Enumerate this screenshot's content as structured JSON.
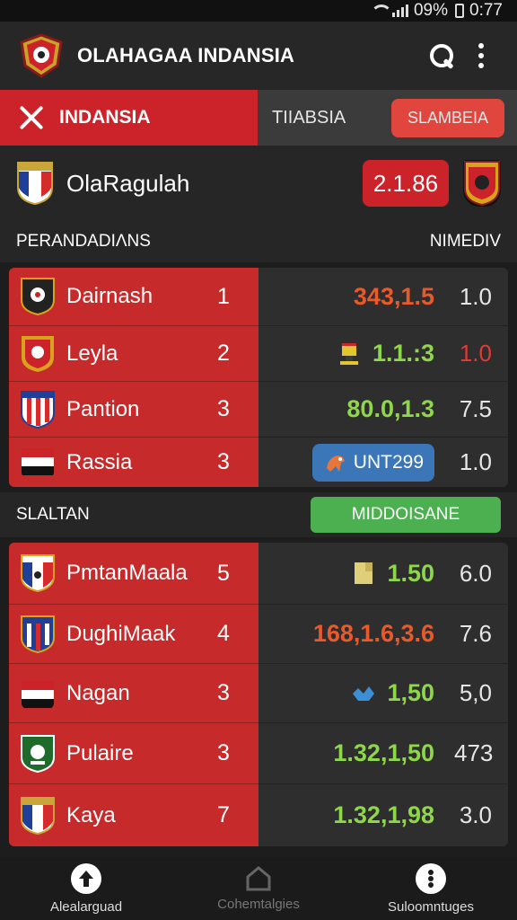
{
  "status": {
    "battery": "09%",
    "time": "0:77"
  },
  "app": {
    "title": "OLAHAGAA INDANSIA"
  },
  "tabs": {
    "active_label": "INDANSIA",
    "inactive_label": "TIIABSIA",
    "button_label": "SLAMBEIA"
  },
  "match": {
    "name": "OlaRagulah",
    "score": "2.1.86"
  },
  "section1": {
    "title": "PERANDADIΛNS",
    "right": "NIMEDIV"
  },
  "table1": [
    {
      "name": "Dairnash",
      "pos": "1",
      "odds": "343,1.5",
      "last": "1.0",
      "crest_icon": "shield-crest-icon"
    },
    {
      "name": "Leyla",
      "pos": "2",
      "odds": "1.1.:3",
      "last": "1.0",
      "crest_icon": "eagle-crest-icon"
    },
    {
      "name": "Pantion",
      "pos": "3",
      "odds": "80.0,1.3",
      "last": "7.5",
      "crest_icon": "striped-crest-icon"
    },
    {
      "name": "Rassia",
      "pos": "3",
      "odds": "UNT299",
      "last": "1.0",
      "crest_icon": "flag-crest-icon"
    }
  ],
  "section2": {
    "title": "SLALTAN",
    "badge": "MIDDOISANE"
  },
  "table2": [
    {
      "name": "PmtanMaala",
      "pos": "5",
      "odds": "1.50",
      "last": "6.0",
      "crest_icon": "shield-crest-icon"
    },
    {
      "name": "DughiMaak",
      "pos": "4",
      "odds": "168,1.6,3.6",
      "last": "7.6",
      "crest_icon": "striped-crest-icon"
    },
    {
      "name": "Nagan",
      "pos": "3",
      "odds": "1,50",
      "last": "5,0",
      "crest_icon": "flag-crest-icon"
    },
    {
      "name": "Pulaire",
      "pos": "3",
      "odds": "1.32,1,50",
      "last": "473",
      "crest_icon": "green-crest-icon"
    },
    {
      "name": "Kaya",
      "pos": "7",
      "odds": "1.32,1,98",
      "last": "3.0",
      "crest_icon": "flag-crest-icon"
    }
  ],
  "nav": [
    {
      "label": "Alealarguad",
      "icon": "arrow-up-circle-icon"
    },
    {
      "label": "Cohemtalgies",
      "icon": "home-icon"
    },
    {
      "label": "Suloomntuges",
      "icon": "more-circle-icon"
    }
  ],
  "colors": {
    "brand_red": "#cc2229",
    "green": "#4caf50",
    "orange": "#e85a2c",
    "odds_green": "#8ed64a"
  }
}
